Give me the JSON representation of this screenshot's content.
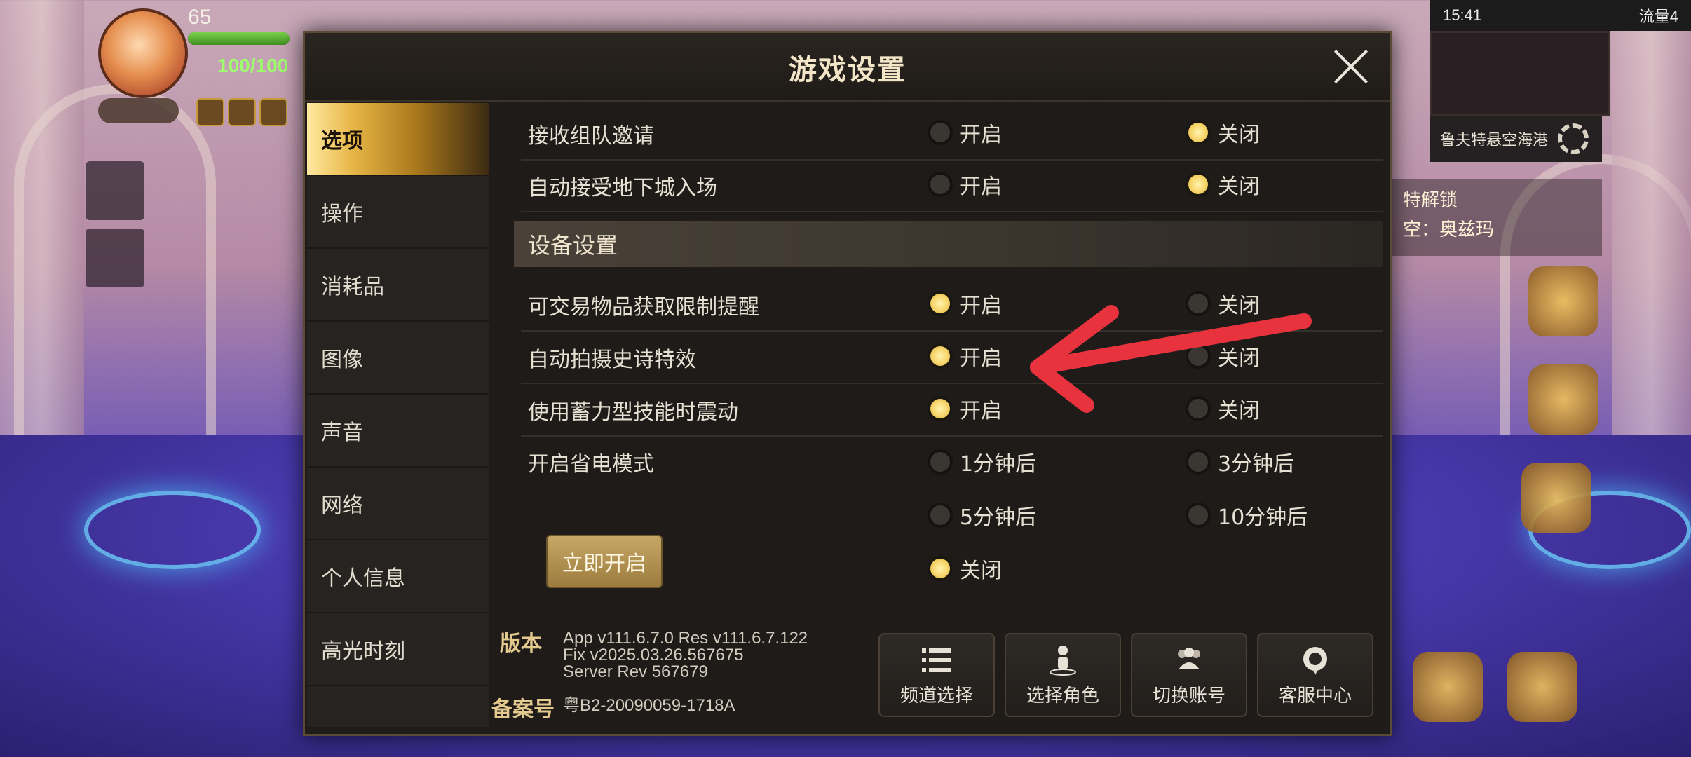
{
  "hud": {
    "level": "65",
    "hp": "100/100",
    "status_time": "15:41",
    "status_right": "流量4",
    "minimap_name": "鲁夫特悬空海港"
  },
  "quest": {
    "line1": "特解锁",
    "line2": "空：奥兹玛"
  },
  "dialog": {
    "title": "游戏设置"
  },
  "sidebar": {
    "items": [
      {
        "label": "选项",
        "active": true
      },
      {
        "label": "操作"
      },
      {
        "label": "消耗品"
      },
      {
        "label": "图像"
      },
      {
        "label": "声音"
      },
      {
        "label": "网络"
      },
      {
        "label": "个人信息"
      },
      {
        "label": "高光时刻"
      }
    ]
  },
  "settings": {
    "rows": [
      {
        "label": "接收组队邀请",
        "options": [
          "开启",
          "关闭"
        ],
        "selected": "关闭"
      },
      {
        "label": "自动接受地下城入场",
        "options": [
          "开启",
          "关闭"
        ],
        "selected": "关闭"
      }
    ],
    "section": "设备设置",
    "device_rows": [
      {
        "label": "可交易物品获取限制提醒",
        "options": [
          "开启",
          "关闭"
        ],
        "selected": "开启"
      },
      {
        "label": "自动拍摄史诗特效",
        "options": [
          "开启",
          "关闭"
        ],
        "selected": "开启"
      },
      {
        "label": "使用蓄力型技能时震动",
        "options": [
          "开启",
          "关闭"
        ],
        "selected": "开启"
      }
    ],
    "power_saving": {
      "label": "开启省电模式",
      "options": [
        "1分钟后",
        "3分钟后",
        "5分钟后",
        "10分钟后",
        "关闭"
      ],
      "selected": "关闭",
      "now_button": "立即开启"
    }
  },
  "footer": {
    "version_label": "版本",
    "version_lines": [
      "App v111.6.7.0 Res v111.6.7.122",
      "Fix v2025.03.26.567675",
      "Server Rev 567679"
    ],
    "record_label": "备案号",
    "record_value": "粤B2-20090059-1718A",
    "buttons": [
      {
        "label": "频道选择",
        "icon": "list-icon"
      },
      {
        "label": "选择角色",
        "icon": "character-icon"
      },
      {
        "label": "切换账号",
        "icon": "users-icon"
      },
      {
        "label": "客服中心",
        "icon": "support-icon"
      }
    ]
  },
  "colors": {
    "accent": "#f7d56a",
    "arrow": "#e8333f",
    "title": "#f3e6c8"
  }
}
